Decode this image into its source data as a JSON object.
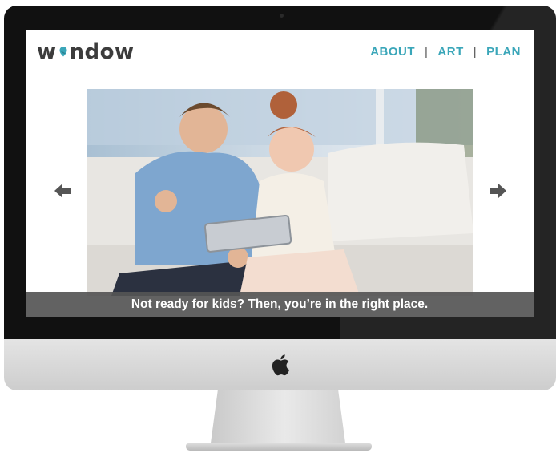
{
  "brand": {
    "logo_prefix": "w",
    "logo_suffix": "ndow",
    "logo_icon": "bird-icon"
  },
  "nav": {
    "items": [
      {
        "label": "ABOUT"
      },
      {
        "label": "ART"
      },
      {
        "label": "PLAN"
      }
    ],
    "separator": "|"
  },
  "hero": {
    "image_alt": "Couple on a sofa looking at a tablet",
    "caption": "Not ready for kids? Then, you’re in the right place.",
    "prev_icon": "arrow-left-icon",
    "next_icon": "arrow-right-icon"
  },
  "device": {
    "logo_icon": "apple-logo-icon"
  },
  "colors": {
    "accent": "#3aa6b9",
    "logo_text": "#3c3c3c",
    "caption_bg": "#555555"
  }
}
